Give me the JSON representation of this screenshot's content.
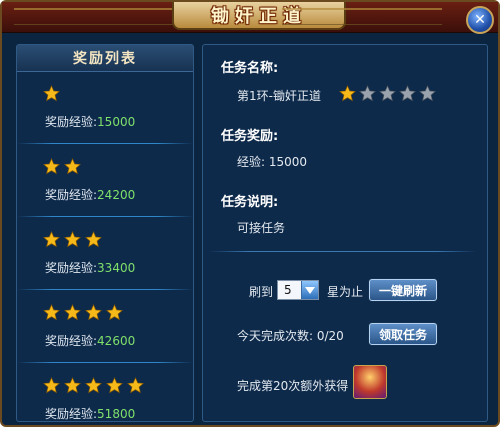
{
  "window": {
    "title": "锄奸正道"
  },
  "reward_list": {
    "header": "奖励列表",
    "items": [
      {
        "stars": 1,
        "label": "奖励经验:",
        "value": "15000"
      },
      {
        "stars": 2,
        "label": "奖励经验:",
        "value": "24200"
      },
      {
        "stars": 3,
        "label": "奖励经验:",
        "value": "33400"
      },
      {
        "stars": 4,
        "label": "奖励经验:",
        "value": "42600"
      },
      {
        "stars": 5,
        "label": "奖励经验:",
        "value": "51800"
      }
    ]
  },
  "task": {
    "name_title": "任务名称:",
    "name_value": "第1环-锄奸正道",
    "rating": {
      "filled": 1,
      "total": 5
    },
    "reward_title": "任务奖励:",
    "reward_value": "经验: 15000",
    "desc_title": "任务说明:",
    "desc_value": "可接任务"
  },
  "controls": {
    "refresh_prefix": "刷到",
    "refresh_select_value": "5",
    "refresh_suffix": "星为止",
    "refresh_button": "一键刷新",
    "daily_count_label": "今天完成次数: 0/20",
    "accept_button": "领取任务",
    "bonus_label": "完成第20次额外获得"
  },
  "colors": {
    "star_filled": "#f6b91a",
    "star_empty": "#9aa3ad",
    "exp_value": "#7fe06a"
  },
  "icons": {
    "close": "close-icon",
    "star": "star-icon",
    "dropdown": "chevron-down-icon",
    "reward_item": "reward-item-icon"
  }
}
